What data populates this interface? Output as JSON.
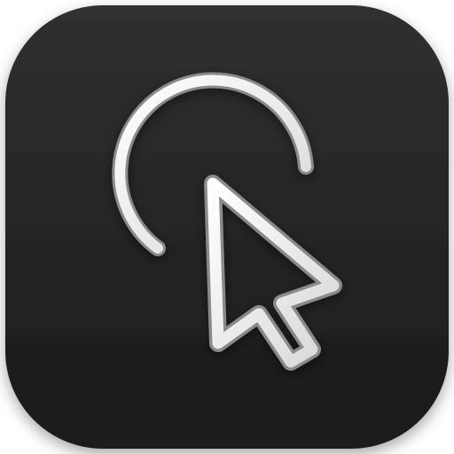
{
  "icon": {
    "name": "click-cursor-app-icon",
    "tile_color": "#1f1f1f",
    "tile_highlight": "#343434",
    "glyph_color": "#f2f2f2",
    "glyph_shadow": "#9a9a9a",
    "glyphs": [
      "arc-icon",
      "arrow-cursor-icon"
    ]
  }
}
